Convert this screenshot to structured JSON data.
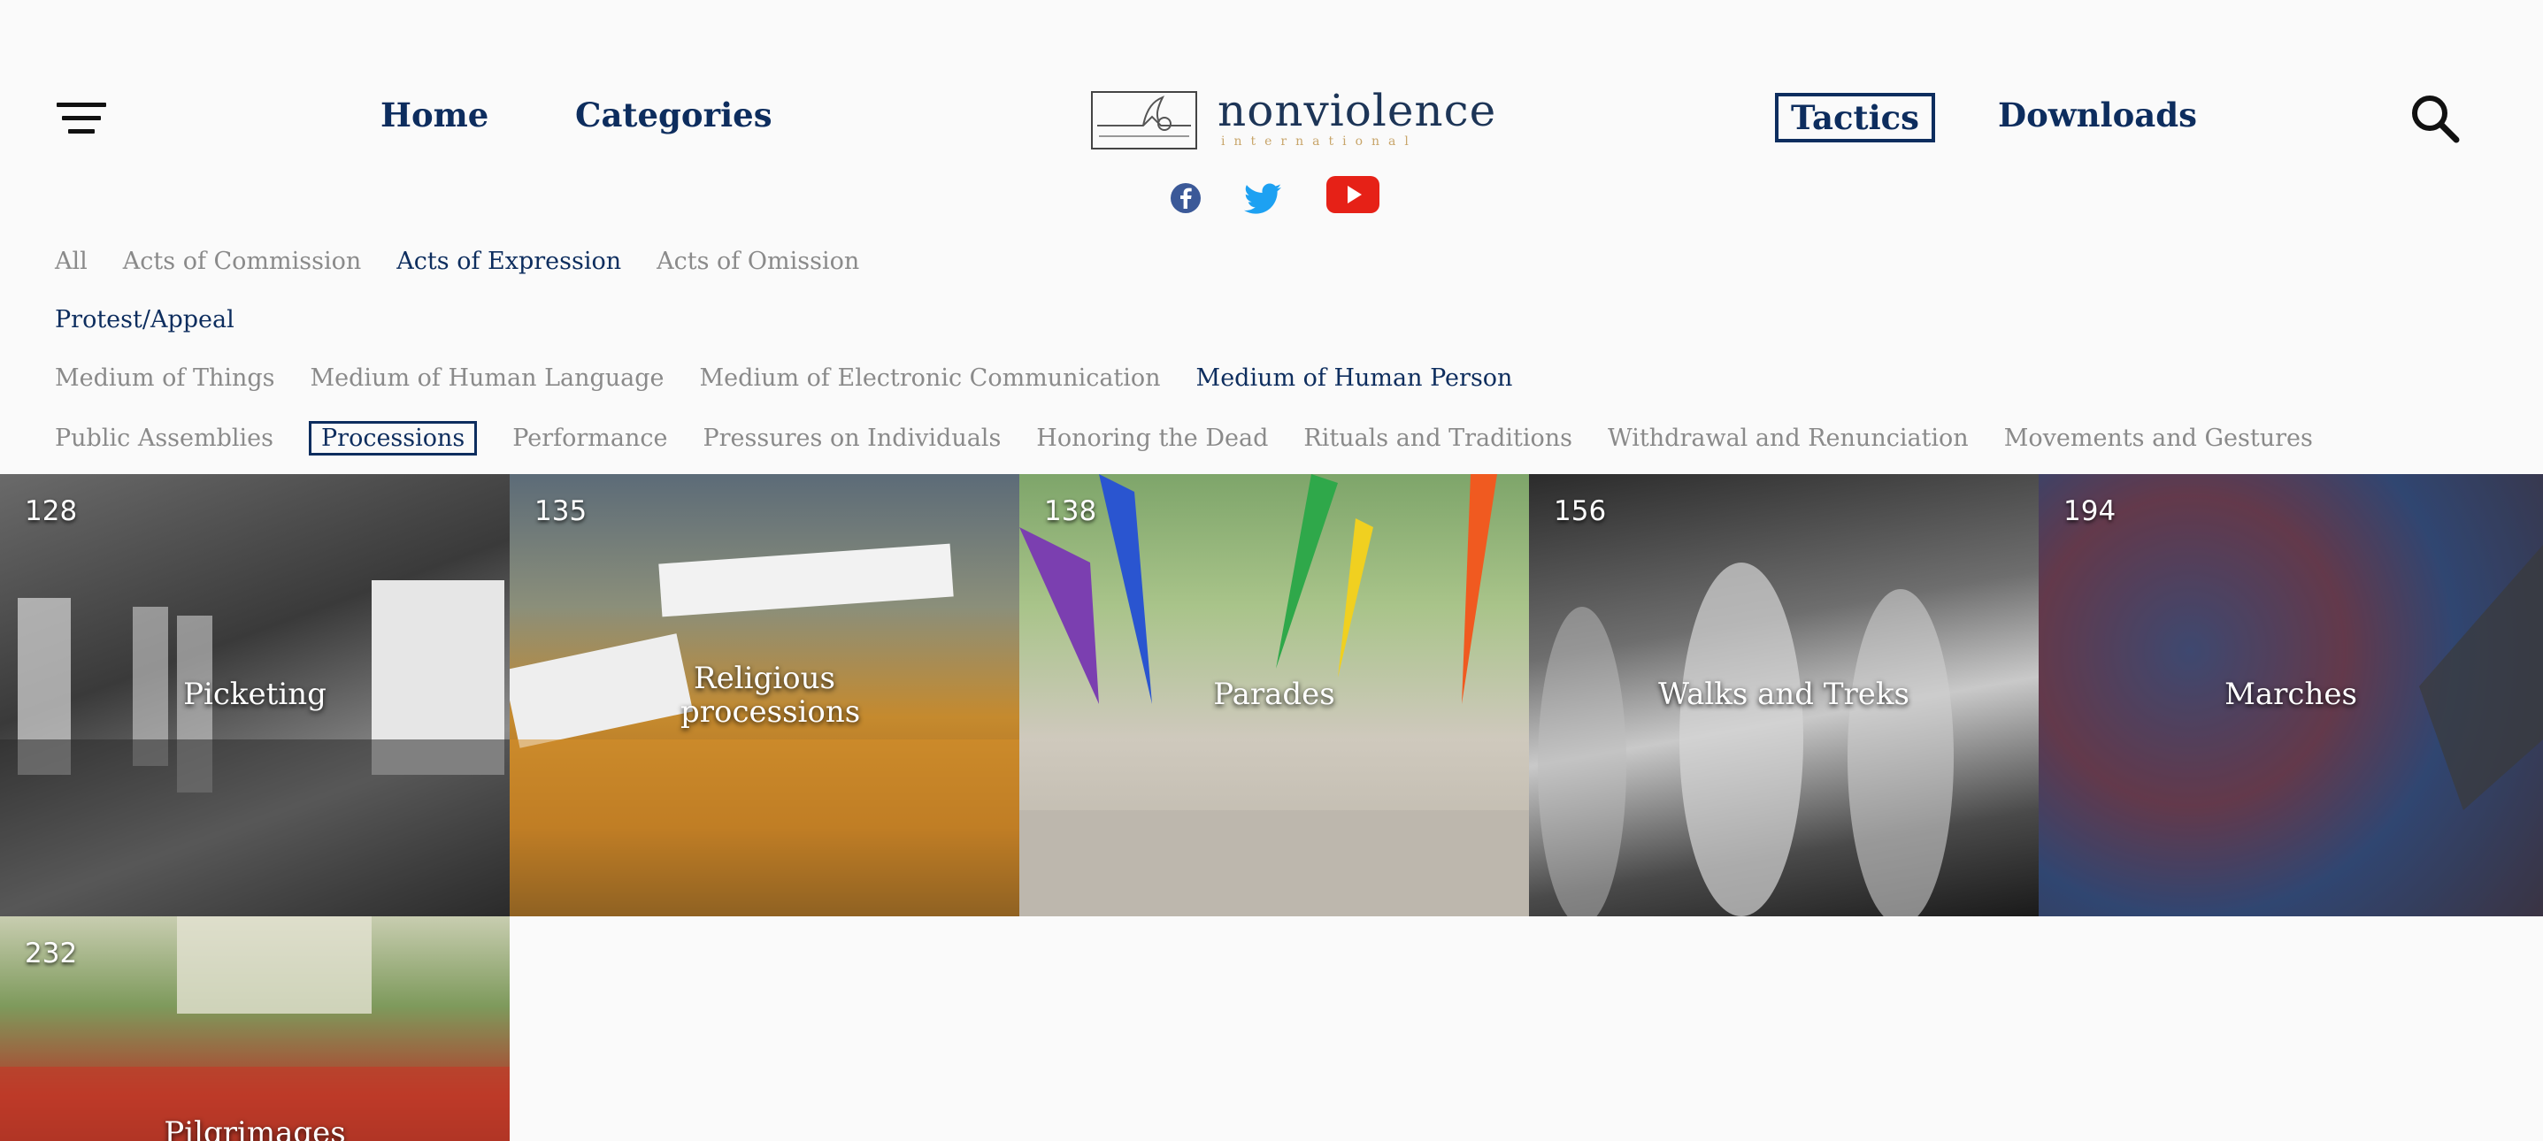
{
  "header": {
    "nav": {
      "home": "Home",
      "categories": "Categories",
      "tactics": "Tactics",
      "downloads": "Downloads"
    },
    "logo": {
      "word": "nonviolence",
      "sub": "international"
    },
    "icons": {
      "menu": "menu-filter-icon",
      "search": "search-icon",
      "facebook": "facebook-icon",
      "twitter": "twitter-icon",
      "youtube": "youtube-icon"
    },
    "colors": {
      "brand": "#0d2d5e",
      "facebook": "#3b5998",
      "twitter": "#1da1f2",
      "youtube": "#e62117",
      "logo_sub": "#c8a56a"
    }
  },
  "filters": {
    "row1": [
      "All",
      "Acts of Commission",
      "Acts of Expression",
      "Acts of Omission"
    ],
    "row1_active": "Acts of Expression",
    "row2": [
      "Protest/Appeal"
    ],
    "row3": [
      "Medium of Things",
      "Medium of Human Language",
      "Medium of Electronic Communication",
      "Medium of Human Person"
    ],
    "row3_active": "Medium of Human Person",
    "row4": [
      "Public Assemblies",
      "Processions",
      "Performance",
      "Pressures on Individuals",
      "Honoring the Dead",
      "Rituals and Traditions",
      "Withdrawal and Renunciation",
      "Movements and Gestures"
    ],
    "row4_selected": "Processions"
  },
  "tiles": [
    {
      "number": "128",
      "label": "Picketing"
    },
    {
      "number": "135",
      "label": "Religious processions"
    },
    {
      "number": "138",
      "label": "Parades"
    },
    {
      "number": "156",
      "label": "Walks and Treks"
    },
    {
      "number": "194",
      "label": "Marches"
    },
    {
      "number": "232",
      "label": "Pilgrimages"
    }
  ]
}
